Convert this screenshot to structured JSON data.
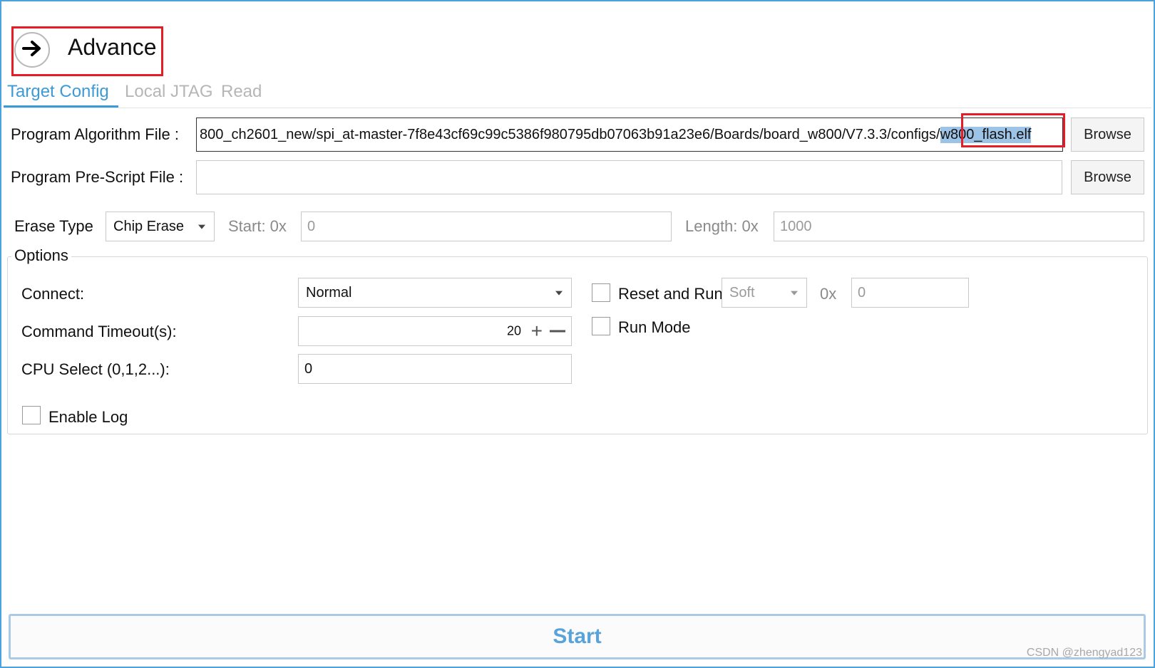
{
  "header": {
    "title": "Advance",
    "back_icon": "arrow-right-icon"
  },
  "tabs": [
    {
      "label": "Target Config",
      "active": true
    },
    {
      "label": "Local JTAG",
      "active": false
    },
    {
      "label": "Read",
      "active": false
    }
  ],
  "program_algorithm": {
    "label": "Program Algorithm File :",
    "path_prefix": "800_ch2601_new/spi_at-master-7f8e43cf69c99c5386f980795db07063b91a23e6/Boards/board_w800/V7.3.3/configs/",
    "path_selected": "w800_flash.elf",
    "browse_label": "Browse"
  },
  "program_prescript": {
    "label": "Program Pre-Script File :",
    "value": "",
    "browse_label": "Browse"
  },
  "erase": {
    "label": "Erase Type",
    "type_value": "Chip Erase",
    "start_label": "Start: 0x",
    "start_value": "0",
    "length_label": "Length: 0x",
    "length_value": "1000"
  },
  "options": {
    "legend": "Options",
    "connect_label": "Connect:",
    "connect_value": "Normal",
    "timeout_label": "Command Timeout(s):",
    "timeout_value": "20",
    "cpu_label": "CPU Select (0,1,2...):",
    "cpu_value": "0",
    "reset_run_label": "Reset and Run",
    "reset_mode_value": "Soft",
    "reset_hex_prefix": "0x",
    "reset_hex_value": "0",
    "run_mode_label": "Run Mode",
    "enable_log_label": "Enable Log"
  },
  "start_label": "Start",
  "watermark": "CSDN @zhengyad123",
  "colors": {
    "accent": "#3c9ad7",
    "highlight_box": "#e81c24",
    "start_text": "#5aa3d8"
  }
}
